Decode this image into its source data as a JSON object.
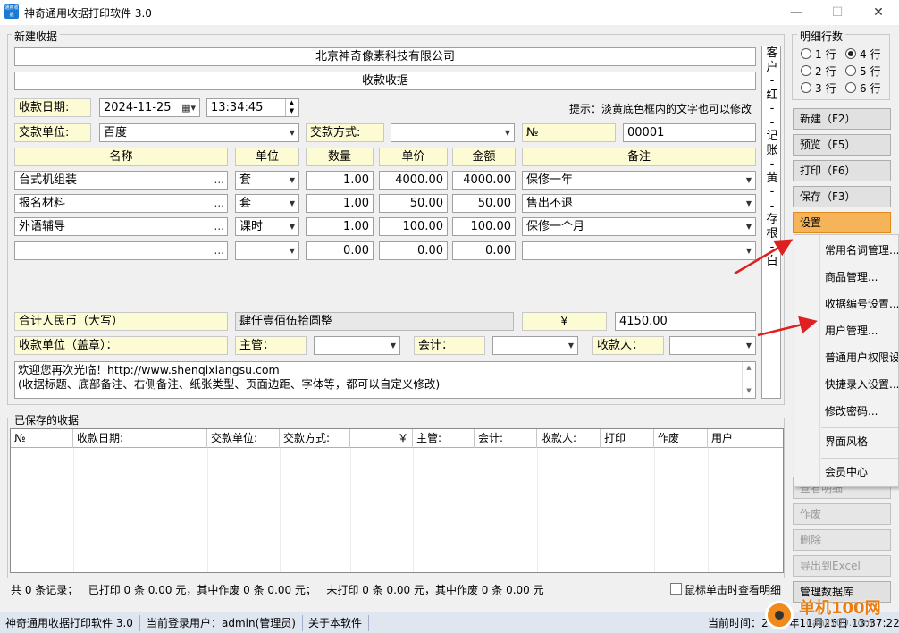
{
  "window": {
    "title": "神奇通用收据打印软件 3.0",
    "app_icon_text": "通用收据",
    "minimize": "—",
    "maximize": "☐",
    "close": "✕"
  },
  "receipt": {
    "group_title": "新建收据",
    "company": "北京神奇像素科技有限公司",
    "doc_title": "收款收据",
    "date_label": "收款日期:",
    "date_value": "2024-11-25",
    "time_value": "13:34:45",
    "hint": "提示：淡黄底色框内的文字也可以修改",
    "payer_label": "交款单位:",
    "payer_value": "百度",
    "method_label": "交款方式:",
    "method_value": "",
    "no_label": "№",
    "no_value": "00001",
    "headers": {
      "name": "名称",
      "unit": "单位",
      "qty": "数量",
      "price": "单价",
      "amount": "金额",
      "remark": "备注"
    },
    "rows": [
      {
        "name": "台式机组装",
        "unit": "套",
        "qty": "1.00",
        "price": "4000.00",
        "amount": "4000.00",
        "remark": "保修一年"
      },
      {
        "name": "报名材料",
        "unit": "套",
        "qty": "1.00",
        "price": "50.00",
        "amount": "50.00",
        "remark": "售出不退"
      },
      {
        "name": "外语辅导",
        "unit": "课时",
        "qty": "1.00",
        "price": "100.00",
        "amount": "100.00",
        "remark": "保修一个月"
      },
      {
        "name": "",
        "unit": "",
        "qty": "0.00",
        "price": "0.00",
        "amount": "0.00",
        "remark": ""
      }
    ],
    "total_label": "合计人民币（大写）",
    "total_words": "肆仟壹佰伍拾圆整",
    "yen": "￥",
    "total_value": "4150.00",
    "seal_label": "收款单位（盖章）：",
    "manager_label": "主管：",
    "accountant_label": "会计：",
    "receiver_label": "收款人：",
    "footer_text": "欢迎您再次光临！http://www.shenqixiangsu.com\n(收据标题、底部备注、右侧备注、纸张类型、页面边距、字体等，都可以自定义修改)",
    "side_note": [
      "客",
      "户",
      "-",
      "红",
      "-",
      "-",
      "记",
      "账",
      "-",
      "黄",
      "-",
      "-",
      "存",
      "根",
      "-",
      "白"
    ]
  },
  "detail_rows": {
    "title": "明细行数",
    "options": [
      {
        "label": "1 行",
        "checked": false
      },
      {
        "label": "4 行",
        "checked": true
      },
      {
        "label": "2 行",
        "checked": false
      },
      {
        "label": "5 行",
        "checked": false
      },
      {
        "label": "3 行",
        "checked": false
      },
      {
        "label": "6 行",
        "checked": false
      }
    ]
  },
  "buttons": {
    "new": "新建（F2）",
    "preview": "预览（F5）",
    "print": "打印（F6）",
    "save": "保存（F3）",
    "settings": "设置",
    "view_detail": "查看明细",
    "void": "作废",
    "delete": "删除",
    "export": "导出到Excel",
    "manage": "管理数据库"
  },
  "settings_menu": [
    "常用名词管理...",
    "商品管理...",
    "收据编号设置...",
    "用户管理...",
    "普通用户权限设置...",
    "快捷录入设置...",
    "修改密码...",
    "界面风格",
    "会员中心"
  ],
  "saved": {
    "group_title": "已保存的收据",
    "columns": [
      "№",
      "收款日期:",
      "交款单位:",
      "交款方式:",
      "￥",
      "主管:",
      "会计:",
      "收款人:",
      "打印",
      "作废",
      "用户"
    ],
    "summary": "共 0 条记录；   已打印 0 条 0.00 元，其中作废 0 条 0.00 元；   未打印 0 条 0.00 元，其中作废 0 条 0.00 元",
    "click_hint": "鼠标单击时查看明细"
  },
  "status": {
    "app": "神奇通用收据打印软件 3.0",
    "user": "当前登录用户：admin(管理员)",
    "about": "关于本软件",
    "time": "当前时间：2024年11月25日 13:37:22"
  },
  "watermark": "单机100网",
  "watermark_sub": "danji100.com",
  "colors": {
    "yellow_field": "#fdfbd3",
    "active_button": "#f5b45a",
    "arrow": "#e02020",
    "status_bar": "#dfe6f0"
  }
}
